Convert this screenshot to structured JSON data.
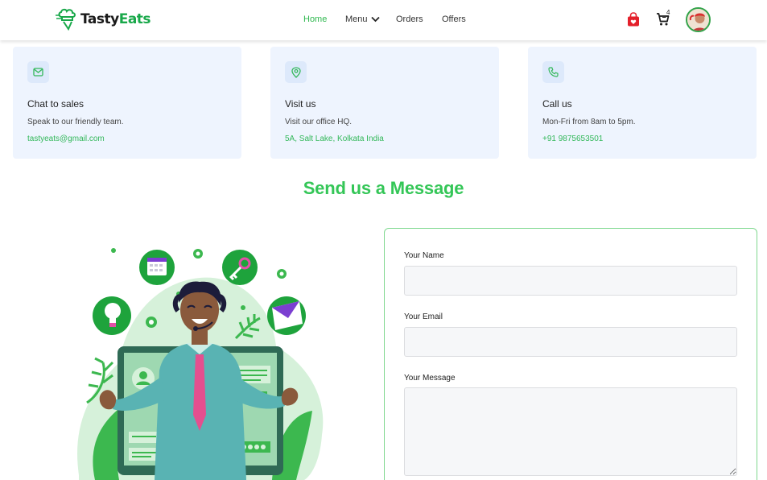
{
  "brand": {
    "name_part1": "Tasty",
    "name_part2": "Eats"
  },
  "nav": {
    "links": [
      {
        "label": "Home",
        "active": true
      },
      {
        "label": "Menu",
        "has_dropdown": true
      },
      {
        "label": "Orders"
      },
      {
        "label": "Offers"
      }
    ],
    "cart_count": "4",
    "icons": [
      "shopping-bag-icon",
      "cart-icon",
      "avatar"
    ]
  },
  "contact_cards": [
    {
      "icon": "mail-icon",
      "title": "Chat to sales",
      "description": "Speak to our friendly team.",
      "link": "tastyeats@gmail.com"
    },
    {
      "icon": "map-pin-icon",
      "title": "Visit us",
      "description": "Visit our office HQ.",
      "link": "5A, Salt Lake, Kolkata India"
    },
    {
      "icon": "phone-icon",
      "title": "Call us",
      "description": "Mon-Fri from 8am to 5pm.",
      "link": "+91 9875653501"
    }
  ],
  "section_title": "Send us a Message",
  "form": {
    "fields": [
      {
        "label": "Your Name",
        "value": ""
      },
      {
        "label": "Your Email",
        "value": ""
      },
      {
        "label": "Your Message",
        "value": ""
      }
    ]
  },
  "colors": {
    "accent": "#34c657",
    "card_bg": "#eef4fe",
    "link": "#33b85a",
    "bag_red": "#e4202b"
  }
}
